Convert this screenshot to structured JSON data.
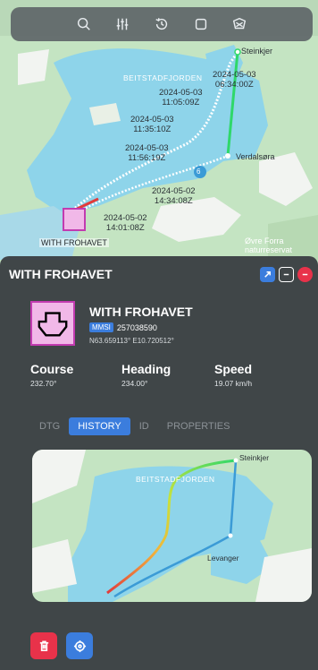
{
  "colors": {
    "accent": "#3b7ddd",
    "track_start": "#e23b3b",
    "track_end": "#2fd86a",
    "delete": "#e8324a",
    "ship_fill": "#f1b8e8",
    "ship_border": "#c23bb0"
  },
  "toolbar": {
    "icons": [
      "search-icon",
      "sliders-icon",
      "history-icon",
      "square-icon",
      "chart-cross-icon"
    ]
  },
  "map": {
    "places": {
      "steinkjer": "Steinkjer",
      "fjord": "BEITSTADFJORDEN",
      "verdalsora": "Verdalsøra",
      "ovre_line1": "Øvre Forra",
      "ovre_line2": "naturreservat"
    },
    "timestamps": [
      {
        "date": "2024-05-03",
        "time": "06:34:00Z"
      },
      {
        "date": "2024-05-03",
        "time": "11:05:09Z"
      },
      {
        "date": "2024-05-03",
        "time": "11:35:10Z"
      },
      {
        "date": "2024-05-03",
        "time": "11:56:19Z"
      },
      {
        "date": "2024-05-02",
        "time": "14:34:08Z"
      },
      {
        "date": "2024-05-02",
        "time": "14:01:08Z"
      }
    ],
    "cluster_count": "6",
    "ship_label": "WITH FROHAVET"
  },
  "panel": {
    "title": "WITH FROHAVET",
    "ship_name": "WITH FROHAVET",
    "mmsi_label": "MMSI",
    "mmsi_value": "257038590",
    "coordinates": "N63.659113° E10.720512°",
    "stats": [
      {
        "label": "Course",
        "value": "232.70°"
      },
      {
        "label": "Heading",
        "value": "234.00°"
      },
      {
        "label": "Speed",
        "value": "19.07 km/h"
      }
    ],
    "tabs": [
      {
        "label": "DTG"
      },
      {
        "label": "HISTORY"
      },
      {
        "label": "ID"
      },
      {
        "label": "PROPERTIES"
      }
    ],
    "active_tab": "HISTORY",
    "mini_map_places": {
      "steinkjer": "Steinkjer",
      "fjord": "BEITSTADFJORDEN",
      "levanger": "Levanger"
    }
  }
}
